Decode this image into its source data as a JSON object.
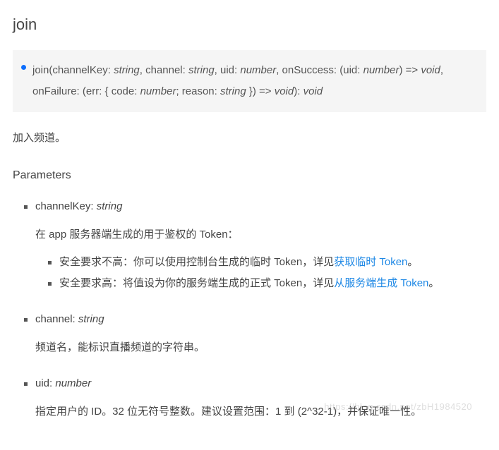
{
  "title": "join",
  "signature": {
    "p1": "join(channelKey: ",
    "t1": "string",
    "p2": ", channel: ",
    "t2": "string",
    "p3": ", uid: ",
    "t3": "number",
    "p4": ", onSuccess: (uid: ",
    "t4": "number",
    "p5": ") => ",
    "t5": "void",
    "p6": ", onFailure: (err: { code: ",
    "t6": "number",
    "p7": "; reason: ",
    "t7": "string",
    "p8": " }) => ",
    "t8": "void",
    "p9": "): ",
    "t9": "void"
  },
  "intro": "加入频道。",
  "paramsHeading": "Parameters",
  "params": [
    {
      "name": "channelKey: ",
      "type": "string",
      "desc": "在 app 服务器端生成的用于鉴权的 Token：",
      "sub": [
        {
          "prefix": "安全要求不高：你可以使用控制台生成的临时 Token，详见",
          "link": "获取临时 Token",
          "suffix": "。"
        },
        {
          "prefix": "安全要求高：将值设为你的服务端生成的正式 Token，详见",
          "link": "从服务端生成 Token",
          "suffix": "。"
        }
      ]
    },
    {
      "name": "channel: ",
      "type": "string",
      "desc": "频道名，能标识直播频道的字符串。"
    },
    {
      "name": "uid: ",
      "type": "number",
      "desc": "指定用户的 ID。32 位无符号整数。建议设置范围：1 到 (2^32-1)，并保证唯一性。"
    }
  ],
  "watermark": "https://blog.csdn.net/zbH1984520"
}
